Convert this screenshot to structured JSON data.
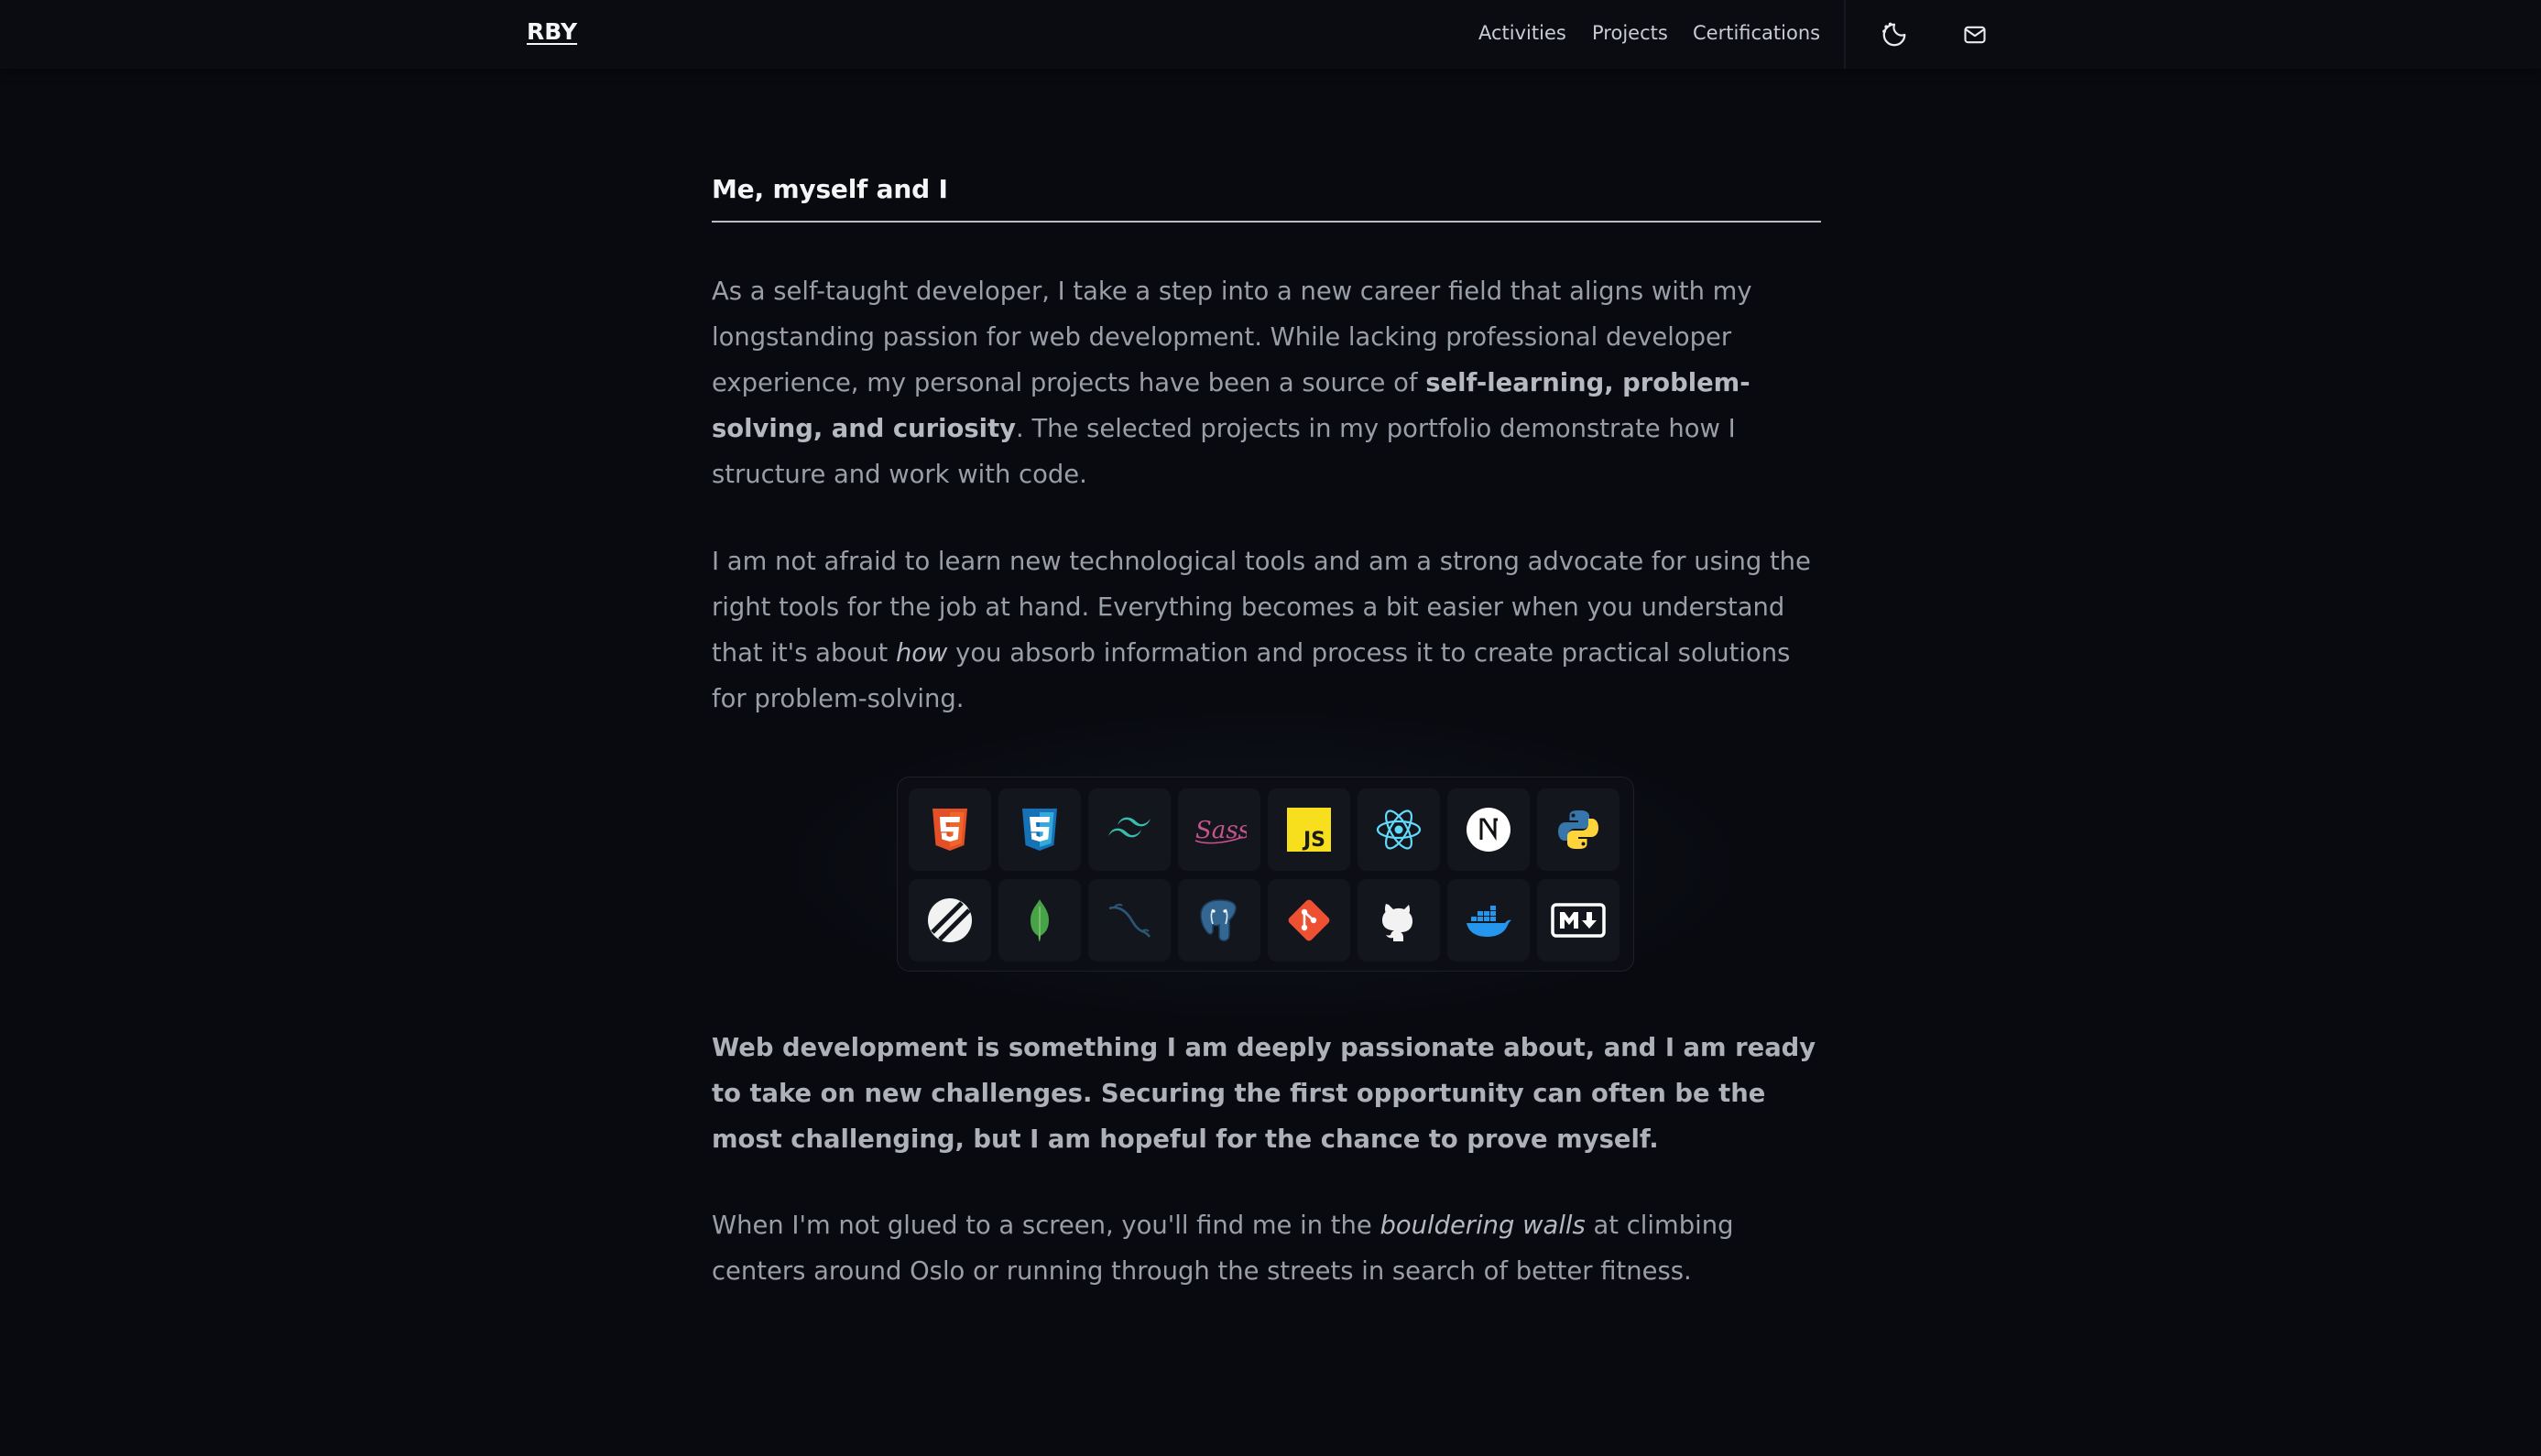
{
  "header": {
    "brand": "RBY",
    "nav": [
      {
        "label": "Activities"
      },
      {
        "label": "Projects"
      },
      {
        "label": "Certifications"
      }
    ],
    "theme_icon": "moon-half-icon",
    "mail_icon": "envelope-icon"
  },
  "main": {
    "title": "Me, myself and I",
    "p1": {
      "a": "As a self-taught developer, I take a step into a new career field that aligns with my longstanding passion for web development. While lacking professional developer experience, my personal projects have been a source of ",
      "b": "self-learning, problem-solving, and curiosity",
      "c": ". The selected projects in my portfolio demonstrate how I structure and work with code."
    },
    "p2": {
      "a": "I am not afraid to learn new technological tools and am a strong advocate for using the right tools for the job at hand. Everything becomes a bit easier when you understand that it's about ",
      "i": "how",
      "c": " you absorb information and process it to create practical solutions for problem-solving."
    },
    "p3": "Web development is something I am deeply passionate about, and I am ready to take on new challenges. Securing the first opportunity can often be the most challenging, but I am hopeful for the chance to prove myself.",
    "p4": {
      "a": "When I'm not glued to a screen, you'll find me in the ",
      "i": "bouldering walls",
      "c": " at climbing centers around Oslo or running through the streets in search of better fitness."
    }
  },
  "tech_icons": [
    "html5-icon",
    "css3-icon",
    "tailwind-icon",
    "sass-icon",
    "javascript-icon",
    "react-icon",
    "nextjs-icon",
    "python-icon",
    "planetscale-icon",
    "mongodb-icon",
    "mysql-icon",
    "postgresql-icon",
    "git-icon",
    "github-icon",
    "docker-icon",
    "markdown-icon"
  ],
  "colors": {
    "background": "#080a10",
    "heading": "#f4f5f7",
    "body_text": "#9a9ea7",
    "tile": "#14161e"
  }
}
